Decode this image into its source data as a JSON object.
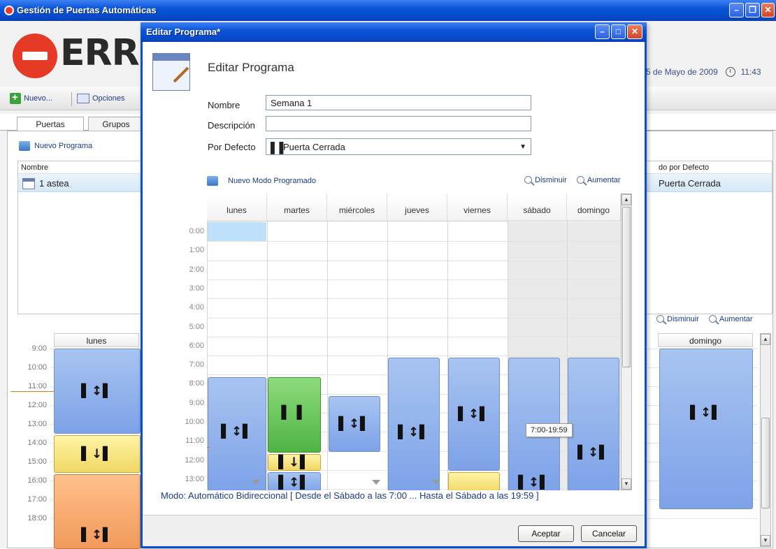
{
  "main_window": {
    "title": "Gestión de Puertas Automáticas",
    "logo_text": "ERR",
    "date_text": "5 de Mayo de 2009",
    "time_text": "11:43",
    "toolbar": {
      "new_label": "Nuevo...",
      "options_label": "Opciones"
    },
    "tabs": [
      "Puertas",
      "Grupos"
    ],
    "new_program_label": "Nuevo Programa",
    "list": {
      "columns": [
        "Nombre",
        "do por Defecto"
      ],
      "rows": [
        {
          "name": "1 astea",
          "default_mode": "Puerta Cerrada"
        }
      ]
    },
    "zoom_out_label": "Disminuir",
    "zoom_in_label": "Aumentar",
    "schedule": {
      "visible_days": [
        "lunes",
        "domingo"
      ],
      "times": [
        "9:00",
        "10:00",
        "11:00",
        "12:00",
        "13:00",
        "14:00",
        "15:00",
        "16:00",
        "17:00",
        "18:00"
      ]
    }
  },
  "dialog": {
    "title": "Editar Programa*",
    "heading": "Editar Programa",
    "labels": {
      "name": "Nombre",
      "description": "Descripción",
      "default": "Por Defecto"
    },
    "values": {
      "name": "Semana 1",
      "description": "",
      "default": "Puerta Cerrada"
    },
    "new_mode_label": "Nuevo Modo Programado",
    "zoom_out_label": "Disminuir",
    "zoom_in_label": "Aumentar",
    "days": [
      "lunes",
      "martes",
      "miércoles",
      "jueves",
      "viernes",
      "sábado",
      "domingo"
    ],
    "times": [
      "0:00",
      "1:00",
      "2:00",
      "3:00",
      "4:00",
      "5:00",
      "6:00",
      "7:00",
      "8:00",
      "9:00",
      "10:00",
      "11:00",
      "12:00",
      "13:00"
    ],
    "tooltip": "7:00-19:59",
    "status": "Modo: Automático Bidireccional [ Desde el Sábado a las 7:00 ... Hasta el Sábado a las 19:59 ]",
    "buttons": {
      "accept": "Aceptar",
      "cancel": "Cancelar"
    }
  },
  "colors": {
    "xp_blue": "#0a55d9",
    "auto_mode_blue": "#7da2e8",
    "yellow_mode": "#f1d765",
    "green_mode": "#4fb444",
    "orange_mode": "#f29a5d",
    "now_line": "#e07a20",
    "selected_cell": "#bfe1fb"
  },
  "icons": {
    "bidirectional": "bidirectional-door-icon",
    "closed": "door-closed-icon",
    "single_direction": "single-direction-door-icon"
  }
}
